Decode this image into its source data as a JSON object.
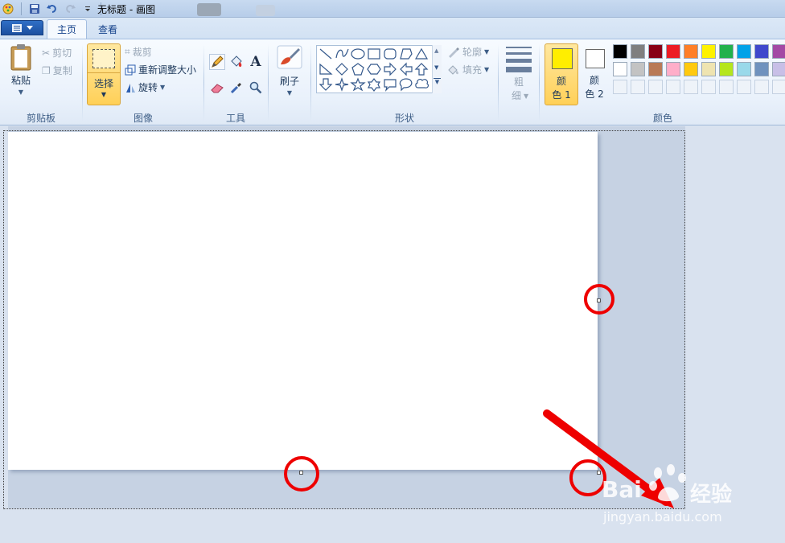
{
  "window": {
    "title": "无标题 - 画图"
  },
  "tabs": [
    {
      "label": "主页",
      "active": true
    },
    {
      "label": "查看",
      "active": false
    }
  ],
  "clipboard": {
    "paste_label": "粘贴",
    "cut_label": "剪切",
    "copy_label": "复制",
    "group_label": "剪贴板"
  },
  "image": {
    "select_label": "选择",
    "crop_label": "裁剪",
    "resize_label": "重新调整大小",
    "rotate_label": "旋转",
    "group_label": "图像"
  },
  "tools": {
    "group_label": "工具",
    "items": [
      "pencil-icon",
      "fill-bucket-icon",
      "text-icon",
      "eraser-icon",
      "color-picker-icon",
      "magnifier-icon"
    ]
  },
  "brushes": {
    "label": "刷子"
  },
  "shapes": {
    "group_label": "形状",
    "outline_label": "轮廓",
    "fill_label": "填充"
  },
  "size": {
    "label_line1": "粗",
    "label_line2": "细"
  },
  "colors": {
    "group_label": "颜色",
    "color1_line1": "颜",
    "color1_line2": "色 1",
    "color2_line1": "颜",
    "color2_line2": "色 2",
    "color1_value": "#ffee00",
    "color2_value": "#ffffff",
    "palette_row1": [
      "#000000",
      "#7f7f7f",
      "#880015",
      "#ed1c24",
      "#ff7f27",
      "#fff200",
      "#22b14c",
      "#00a2e8",
      "#3f48cc",
      "#a349a4"
    ],
    "palette_row2": [
      "#ffffff",
      "#c3c3c3",
      "#b97a57",
      "#ffaec9",
      "#ffc90e",
      "#efe4b0",
      "#b5e61d",
      "#99d9ea",
      "#7092be",
      "#c8bfe7"
    ]
  },
  "watermark": {
    "brand_left": "Bai",
    "brand_right": "经验",
    "url": "jingyan.baidu.com"
  }
}
